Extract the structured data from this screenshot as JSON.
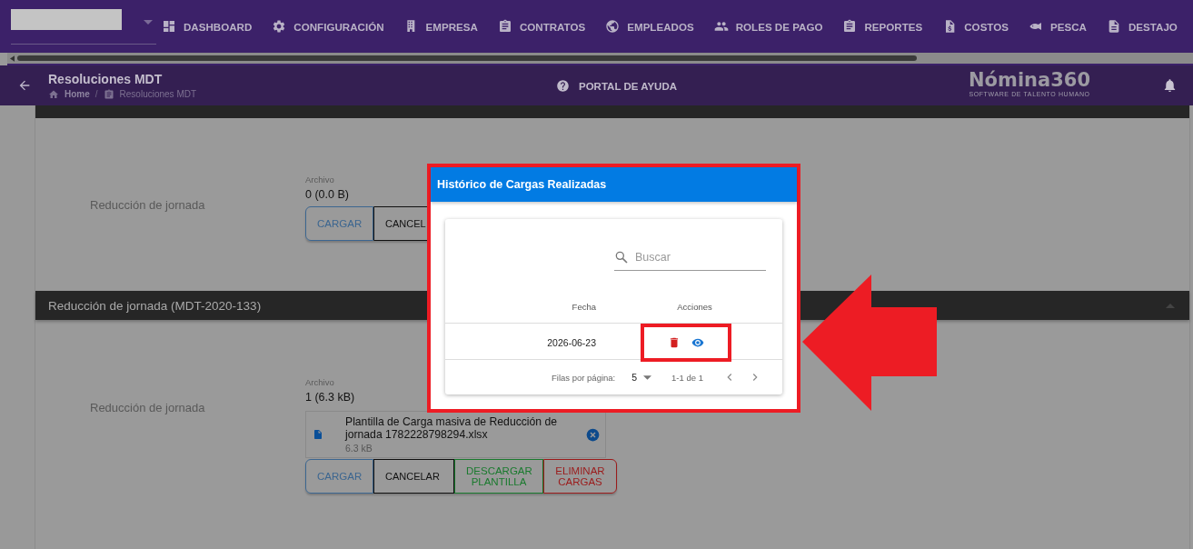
{
  "nav": {
    "items": [
      {
        "label": "DASHBOARD"
      },
      {
        "label": "CONFIGURACIÓN"
      },
      {
        "label": "EMPRESA"
      },
      {
        "label": "CONTRATOS"
      },
      {
        "label": "EMPLEADOS"
      },
      {
        "label": "ROLES DE PAGO"
      },
      {
        "label": "REPORTES"
      },
      {
        "label": "COSTOS"
      },
      {
        "label": "PESCA"
      },
      {
        "label": "DESTAJO"
      }
    ]
  },
  "subheader": {
    "title": "Resoluciones MDT",
    "breadcrumb": [
      {
        "label": "Home"
      },
      {
        "label": "Resoluciones MDT"
      }
    ],
    "breadcrumb_separator": "/",
    "help_link": "PORTAL DE AYUDA",
    "brand": {
      "name": "Nómina360",
      "tagline": "SOFTWARE DE TALENTO HUMANO"
    }
  },
  "sections": [
    {
      "label": "Reducción de jornada",
      "file_label": "Archivo",
      "file_count": "0 (0.0 B)",
      "buttons": [
        {
          "label": "CARGAR",
          "kind": "primary"
        },
        {
          "label": "CANCEL",
          "kind": "default"
        }
      ]
    },
    {
      "title": "Reducción de jornada (MDT-2020-133)",
      "label": "Reducción de jornada",
      "file_label": "Archivo",
      "file_count": "1 (6.3 kB)",
      "file": {
        "name": "Plantilla de Carga masiva de Reducción de jornada 1782228798294.xlsx",
        "size": "6.3 kB"
      },
      "buttons": [
        {
          "label": "CARGAR",
          "kind": "primary"
        },
        {
          "label": "CANCELAR",
          "kind": "default"
        },
        {
          "label": "DESCARGAR PLANTILLA",
          "kind": "success"
        },
        {
          "label": "ELIMINAR CARGAS",
          "kind": "danger"
        }
      ]
    }
  ],
  "dialog": {
    "title": "Histórico de Cargas Realizadas",
    "search": {
      "placeholder": "Buscar"
    },
    "columns": [
      "Fecha",
      "Acciones"
    ],
    "rows": [
      {
        "fecha": "2026-06-23",
        "actions": [
          {
            "kind": "delete"
          },
          {
            "kind": "view"
          }
        ]
      }
    ],
    "footer": {
      "rows_per_page_label": "Filas por página:",
      "rows_per_page": "5",
      "range": "1-1 de 1"
    }
  }
}
